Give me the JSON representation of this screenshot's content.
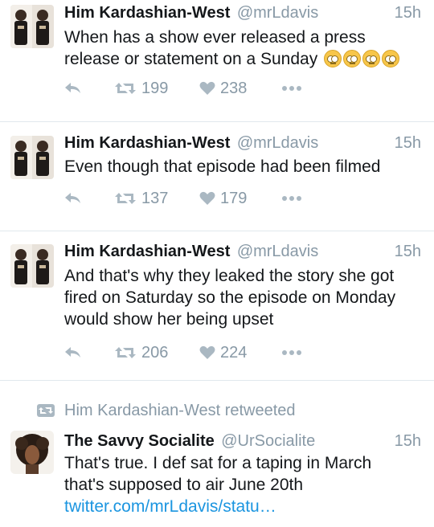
{
  "tweets": [
    {
      "name": "Him Kardashian-West",
      "handle": "@mrLdavis",
      "time": "15h",
      "text": "When has a show ever released a press release or statement on a Sunday",
      "emoji_count": 4,
      "retweets": "199",
      "likes": "238"
    },
    {
      "name": "Him Kardashian-West",
      "handle": "@mrLdavis",
      "time": "15h",
      "text": "Even though that episode had been filmed",
      "retweets": "137",
      "likes": "179"
    },
    {
      "name": "Him Kardashian-West",
      "handle": "@mrLdavis",
      "time": "15h",
      "text": "And that's why they leaked the story she got fired on Saturday so the episode on Monday would show her being upset",
      "retweets": "206",
      "likes": "224"
    }
  ],
  "retweet_banner": "Him Kardashian-West retweeted",
  "retweeted": {
    "name": "The Savvy Socialite",
    "handle": "@UrSocialite",
    "time": "15h",
    "text": "That's true. I def sat for a taping in March that's supposed to air June 20th",
    "link": "twitter.com/mrLdavis/statu…"
  },
  "icons": {
    "reply": "reply-icon",
    "retweet": "retweet-icon",
    "like": "heart-icon",
    "more": "more-dots-icon"
  },
  "colors": {
    "text": "#14171a",
    "muted": "#8899a6",
    "icon": "#aab8c2",
    "link": "#1b95e0",
    "divider": "#e1e8ed"
  }
}
